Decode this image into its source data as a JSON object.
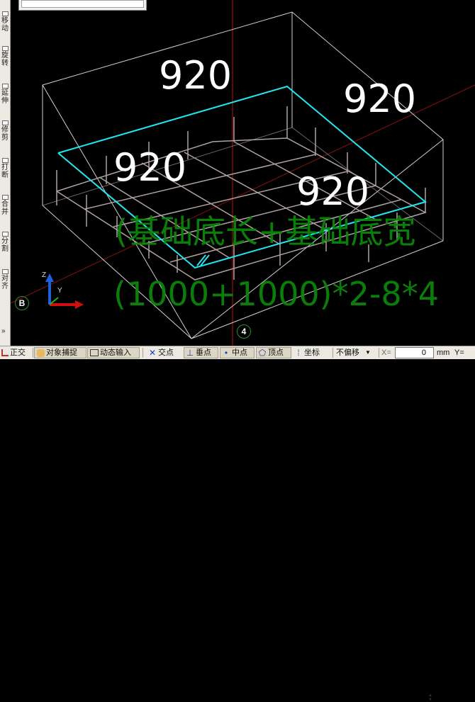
{
  "left_toolbar": {
    "tools": [
      {
        "id": "move",
        "label": "移动"
      },
      {
        "id": "rotate",
        "label": "旋转"
      },
      {
        "id": "extend",
        "label": "延伸"
      },
      {
        "id": "trim",
        "label": "修剪"
      },
      {
        "id": "break",
        "label": "打断"
      },
      {
        "id": "merge",
        "label": "合并"
      },
      {
        "id": "split",
        "label": "分割"
      },
      {
        "id": "align",
        "label": "对齐"
      }
    ],
    "more": "»"
  },
  "viewport": {
    "dimension_labels": [
      "920",
      "920",
      "920",
      "920"
    ],
    "formula_lines": [
      "(基础底长+基础底宽",
      "(1000+1000)*2-8*4"
    ],
    "axis_markers": {
      "left": "B",
      "bottom": "4"
    },
    "ucs": {
      "z": "Z",
      "y": "Y"
    },
    "colors": {
      "box_lines": "#d0d0d0",
      "rebar": "#b0a2a0",
      "highlight": "#22e6f0",
      "formula": "#0a8a0a",
      "red_axis": "#c01010"
    }
  },
  "status_bar": {
    "ortho": "正交",
    "object_snap": "对象捕捉",
    "dynamic_input": "动态输入",
    "intersection": "交点",
    "perpendicular": "垂点",
    "midpoint": "中点",
    "vertex": "顶点",
    "coordinate": "坐标",
    "offset_select": "不偏移",
    "x_label": "X=",
    "x_value": "0",
    "x_unit": "mm",
    "y_label": "Y="
  }
}
